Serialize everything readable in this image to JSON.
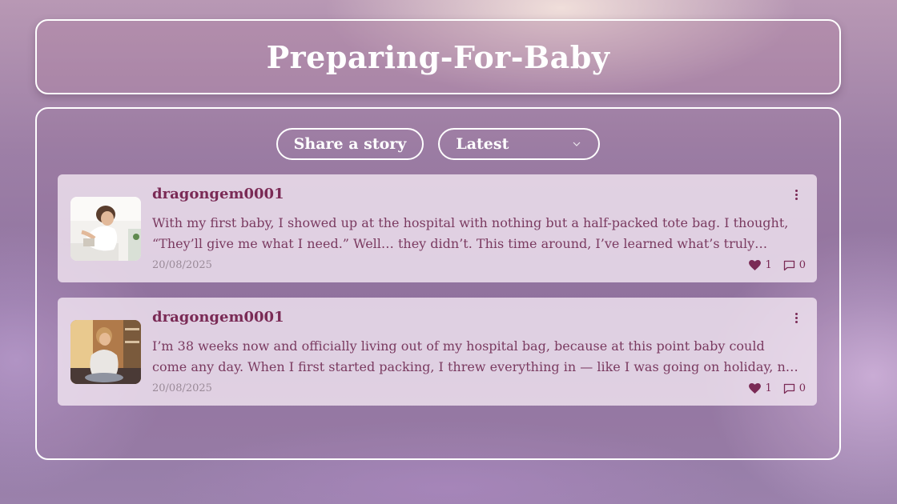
{
  "header": {
    "title": "Preparing-For-Baby"
  },
  "toolbar": {
    "share_label": "Share a story",
    "sort_selected": "Latest"
  },
  "posts": [
    {
      "author": "dragongem0001",
      "excerpt": "With my first baby, I showed up at the hospital with nothing but a half-packed tote bag. I thought, “They’ll give me what I need.” Well… they didn’t. This time around, I’ve learned what’s truly essential for the big day and the days after.",
      "date": "20/08/2025",
      "likes": "1",
      "comments": "0"
    },
    {
      "author": "dragongem0001",
      "excerpt": "I’m 38 weeks now and officially living out of my hospital bag, because at this point baby could come any day. When I first started packing, I threw everything in — like I was going on holiday, not to the hospital.",
      "date": "20/08/2025",
      "likes": "1",
      "comments": "0"
    }
  ],
  "colors": {
    "accent": "#7a2a55",
    "text": "#7a3a60",
    "muted": "#9a8a98",
    "border": "#ffffff"
  },
  "icons": {
    "like": "heart-icon",
    "comment": "comment-icon",
    "menu": "more-vertical-icon",
    "dropdown": "chevron-down-icon"
  }
}
